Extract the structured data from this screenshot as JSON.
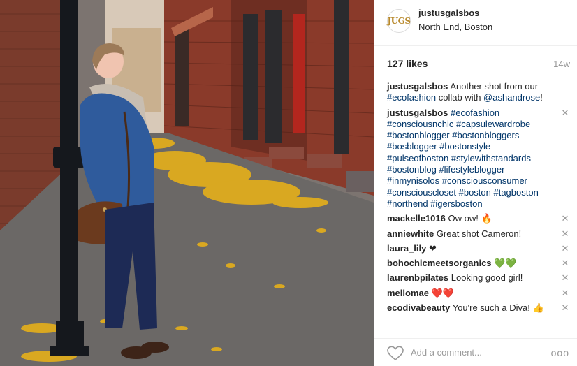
{
  "post": {
    "username": "justusgalsbos",
    "avatar_text": "JUGS",
    "location": "North End, Boston",
    "likes": "127 likes",
    "age": "14w"
  },
  "comments": [
    {
      "user": "justusgalsbos",
      "text_parts": [
        "Another shot from our ",
        "#ecofashion",
        " collab with ",
        "@ashandrose",
        "!"
      ]
    },
    {
      "user": "justusgalsbos",
      "text": "#ecofashion #consciousnchic #capsulewardrobe #bostonblogger #bostonbloggers #bosblogger #bostonstyle #pulseofboston #stylewithstandards #bostonblog #lifestyleblogger #inmynisolos #consciousconsumer #consciouscloset #boston #tagboston #northend #igersboston"
    },
    {
      "user": "mackelle1016",
      "text": "Ow ow! 🔥"
    },
    {
      "user": "anniewhite",
      "text": "Great shot Cameron!"
    },
    {
      "user": "laura_lily",
      "text": "❤"
    },
    {
      "user": "bohochicmeetsorganics",
      "text": "💚💚"
    },
    {
      "user": "laurenbpilates",
      "text": "Looking good girl!"
    },
    {
      "user": "mellomae",
      "text": "❤️❤️"
    },
    {
      "user": "ecodivabeauty",
      "text": "You're such a Diva! 👍"
    }
  ],
  "hashtag_lines": [
    "#ecofashion",
    "#consciousnchic #capsulewardrobe",
    "#bostonblogger #bostonbloggers",
    "#bosblogger #bostonstyle",
    "#pulseofboston #stylewithstandards",
    "#bostonblog #lifestyleblogger",
    "#inmynisolos #consciousconsumer",
    "#consciouscloset #boston #tagboston",
    "#northend #igersboston"
  ],
  "footer": {
    "add_comment_placeholder": "Add a comment...",
    "more_label": "ooo"
  },
  "icons": {
    "close": "close-icon",
    "heart": "heart-outline-icon",
    "more": "more-options-icon"
  },
  "colors": {
    "hashtag": "#003569",
    "muted": "#999999",
    "text": "#262626"
  }
}
